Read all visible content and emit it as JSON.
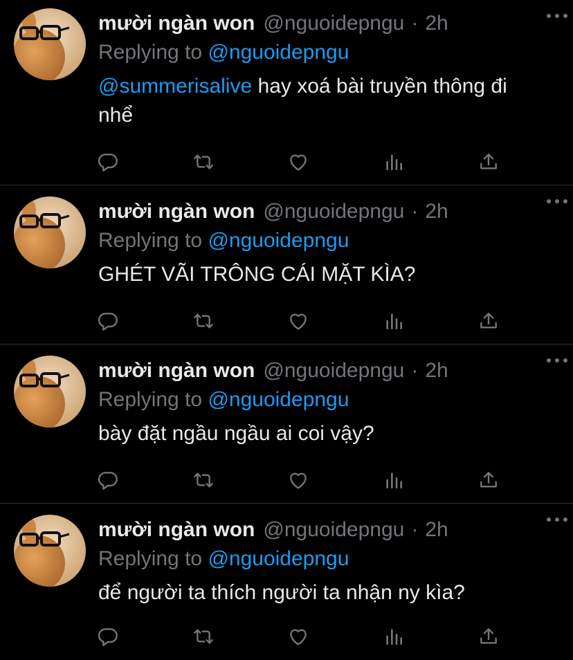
{
  "colors": {
    "background": "#000000",
    "text": "#e7e9ea",
    "muted": "#71767b",
    "link": "#1d9bf0",
    "divider": "#2f3336"
  },
  "icons": [
    "reply-icon",
    "retweet-icon",
    "like-icon",
    "analytics-icon",
    "share-icon",
    "more-icon"
  ],
  "tweets": [
    {
      "name": "mười ngàn won",
      "handle": "@nguoidepngu",
      "separator": "·",
      "time": "2h",
      "replying_prefix": "Replying to",
      "replying_to": "@nguoidepngu",
      "mention": "@summerisalive",
      "text": " hay xoá bài truyền thông đi nhể"
    },
    {
      "name": "mười ngàn won",
      "handle": "@nguoidepngu",
      "separator": "·",
      "time": "2h",
      "replying_prefix": "Replying to",
      "replying_to": "@nguoidepngu",
      "mention": "",
      "text": "GHÉT VÃI TRÔNG CÁI MẶT KÌA?"
    },
    {
      "name": "mười ngàn won",
      "handle": "@nguoidepngu",
      "separator": "·",
      "time": "2h",
      "replying_prefix": "Replying to",
      "replying_to": "@nguoidepngu",
      "mention": "",
      "text": "bày đặt ngầu ngầu ai coi vậy?"
    },
    {
      "name": "mười ngàn won",
      "handle": "@nguoidepngu",
      "separator": "·",
      "time": "2h",
      "replying_prefix": "Replying to",
      "replying_to": "@nguoidepngu",
      "mention": "",
      "text": "để người ta thích người ta nhận ny kìa?"
    }
  ]
}
